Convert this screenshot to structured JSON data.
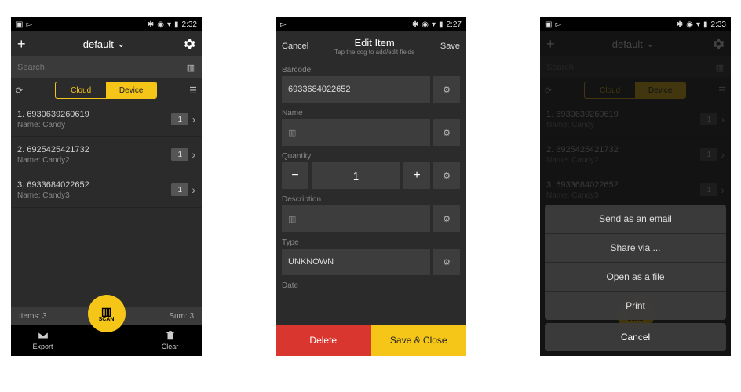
{
  "p1": {
    "time": "2:32",
    "title": "default",
    "search_ph": "Search",
    "tabs": [
      "Cloud",
      "Device"
    ],
    "name_lbl": "Name",
    "items": [
      {
        "idx": "1",
        "code": "6930639260619",
        "name": "Candy",
        "qty": "1"
      },
      {
        "idx": "2",
        "code": "6925425421732",
        "name": "Candy2",
        "qty": "1"
      },
      {
        "idx": "3",
        "code": "6933684022652",
        "name": "Candy3",
        "qty": "1"
      }
    ],
    "items_lbl": "Items",
    "items_n": "3",
    "sum_lbl": "Sum",
    "sum_n": "3",
    "export": "Export",
    "clear": "Clear",
    "scan": "SCAN"
  },
  "p2": {
    "time": "2:27",
    "cancel": "Cancel",
    "save": "Save",
    "title": "Edit Item",
    "sub": "Tap the cog to add/edit fields",
    "lbl_barcode": "Barcode",
    "barcode": "6933684022652",
    "lbl_name": "Name",
    "lbl_qty": "Quantity",
    "qty": "1",
    "lbl_desc": "Description",
    "lbl_type": "Type",
    "type": "UNKNOWN",
    "lbl_date": "Date",
    "delete": "Delete",
    "saveclose": "Save & Close"
  },
  "p3": {
    "time": "2:33",
    "opts": [
      "Send as an email",
      "Share via ...",
      "Open as a file",
      "Print"
    ],
    "cancel": "Cancel"
  }
}
